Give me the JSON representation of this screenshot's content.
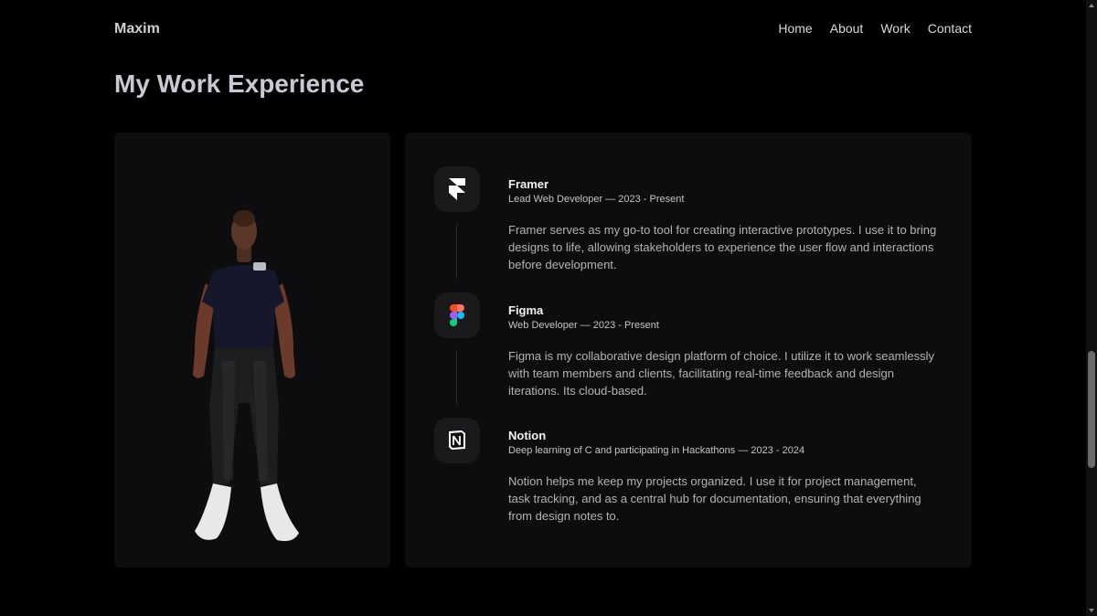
{
  "nav": {
    "brand": "Maxim",
    "links": [
      "Home",
      "About",
      "Work",
      "Contact"
    ]
  },
  "section": {
    "title": "My Work Experience"
  },
  "experience": [
    {
      "company": "Framer",
      "role": "Lead Web Developer — 2023 - Present",
      "description": "Framer serves as my go-to tool for creating interactive prototypes. I use it to bring designs to life, allowing stakeholders to experience the user flow and interactions before development.",
      "icon": "framer-logo-icon"
    },
    {
      "company": "Figma",
      "role": "Web Developer — 2023 - Present",
      "description": "Figma is my collaborative design platform of choice. I utilize it to work seamlessly with team members and clients, facilitating real-time feedback and design iterations. Its cloud-based.",
      "icon": "figma-logo-icon"
    },
    {
      "company": "Notion",
      "role": "Deep learning of C and participating in Hackathons — 2023 - 2024",
      "description": "Notion helps me keep my projects organized. I use it for project management, task tracking, and as a central hub for documentation, ensuring that everything from design notes to.",
      "icon": "notion-logo-icon"
    }
  ],
  "colors": {
    "background": "#000000",
    "card": "#0d0d0f",
    "icon_tile": "#1a1a1c",
    "title": "#c9c9d3"
  }
}
